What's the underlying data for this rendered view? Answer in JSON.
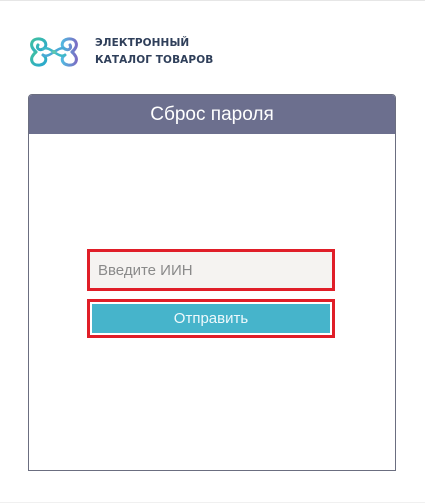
{
  "brand": {
    "line1": "ЭЛЕКТРОННЫЙ",
    "line2": "КАТАЛОГ ТОВАРОВ",
    "logo_icon": "ornament-logo-icon"
  },
  "card": {
    "title": "Сброс пароля"
  },
  "form": {
    "iin_value": "",
    "iin_placeholder": "Введите ИИН",
    "submit_label": "Отправить"
  },
  "colors": {
    "header": "#6c6f8e",
    "button": "#46b4cb",
    "highlight": "#e01e28",
    "brand_text": "#2f3f5a"
  }
}
